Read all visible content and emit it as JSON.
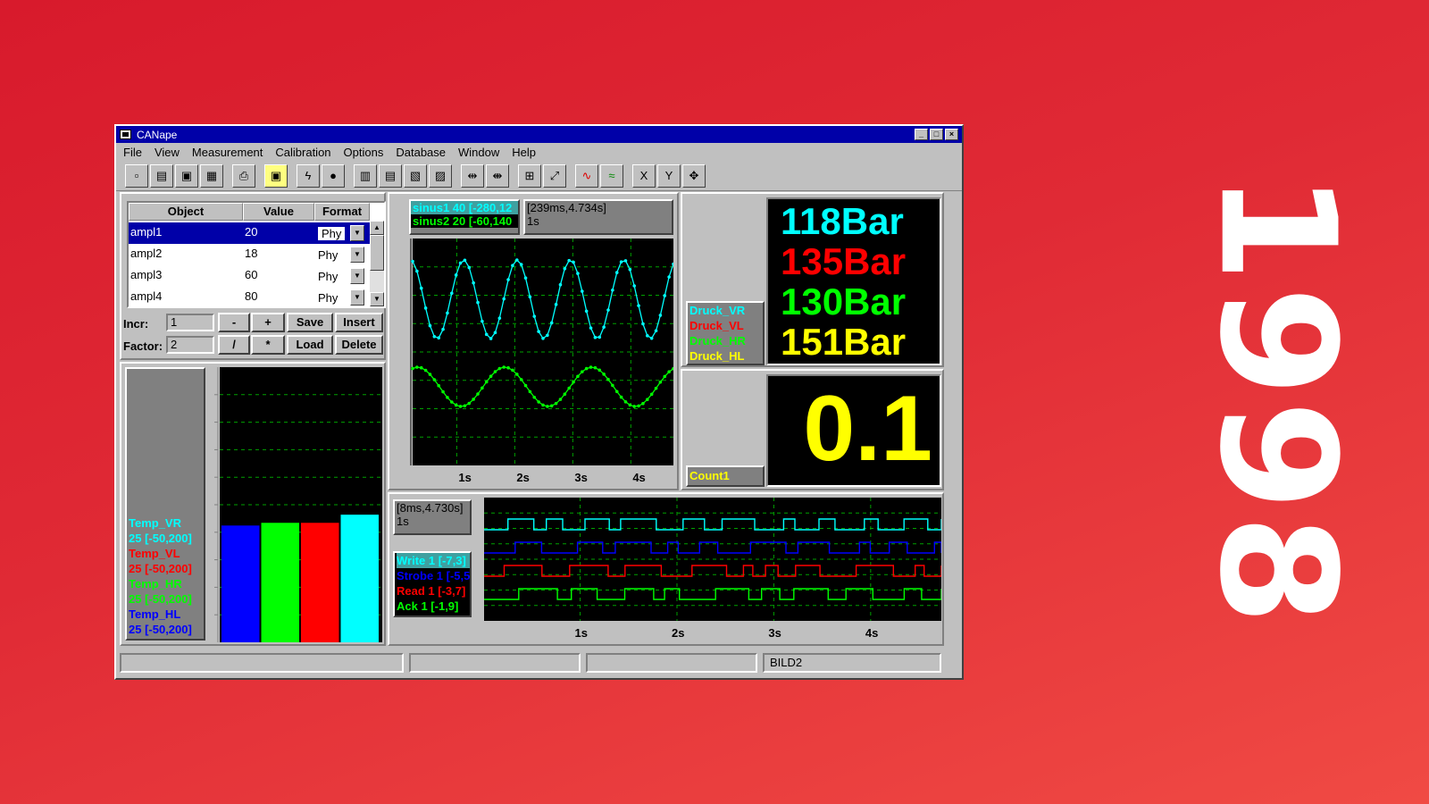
{
  "year": "1998",
  "window": {
    "title": "CANape",
    "controls": [
      "_",
      "□",
      "×"
    ]
  },
  "menu": [
    "File",
    "View",
    "Measurement",
    "Calibration",
    "Options",
    "Database",
    "Window",
    "Help"
  ],
  "table": {
    "headers": [
      "Object",
      "Value",
      "Format"
    ],
    "rows": [
      {
        "object": "ampl1",
        "value": "20",
        "format": "Phy"
      },
      {
        "object": "ampl2",
        "value": "18",
        "format": "Phy"
      },
      {
        "object": "ampl3",
        "value": "60",
        "format": "Phy"
      },
      {
        "object": "ampl4",
        "value": "80",
        "format": "Phy"
      }
    ]
  },
  "calib": {
    "incr_label": "Incr:",
    "incr_value": "1",
    "factor_label": "Factor:",
    "factor_value": "2",
    "minus": "-",
    "plus": "+",
    "divide": "/",
    "multiply": "*",
    "save": "Save",
    "insert": "Insert",
    "load": "Load",
    "delete": "Delete"
  },
  "bars": {
    "legend": [
      {
        "name": "Temp_VR",
        "range": "25 [-50,200]",
        "color": "#00ffff"
      },
      {
        "name": "Temp_VL",
        "range": "25 [-50,200]",
        "color": "#ff0000"
      },
      {
        "name": "Temp_HR",
        "range": "25 [-50,200]",
        "color": "#00ff00"
      },
      {
        "name": "Temp_HL",
        "range": "25 [-50,200]",
        "color": "#0000ff"
      }
    ],
    "values": [
      0.43,
      0.44,
      0.44,
      0.47
    ],
    "colors": [
      "#0000ff",
      "#00ff00",
      "#ff0000",
      "#00ffff"
    ]
  },
  "scope1": {
    "legend": [
      {
        "label": "sinus1 40 [-280,12",
        "color": "#00ffff"
      },
      {
        "label": "sinus2 20 [-60,140",
        "color": "#00ff00"
      }
    ],
    "time_range": "[239ms,4.734s]",
    "time_div": "1s",
    "x_ticks": [
      "1s",
      "2s",
      "3s",
      "4s"
    ]
  },
  "pressure": {
    "legend": [
      {
        "name": "Druck_VR",
        "color": "#00ffff"
      },
      {
        "name": "Druck_VL",
        "color": "#ff0000"
      },
      {
        "name": "Druck_HR",
        "color": "#00ff00"
      },
      {
        "name": "Druck_HL",
        "color": "#ffff00"
      }
    ],
    "readouts": [
      {
        "text": "118Bar",
        "color": "#00ffff"
      },
      {
        "text": "135Bar",
        "color": "#ff0000"
      },
      {
        "text": "130Bar",
        "color": "#00ff00"
      },
      {
        "text": "151Bar",
        "color": "#ffff00"
      }
    ]
  },
  "counter": {
    "label": "Count1",
    "value": "0.1",
    "color": "#ffff00"
  },
  "scope2": {
    "time_range": "[8ms,4.730s]",
    "time_div": "1s",
    "legend": [
      {
        "label": "Write 1 [-7,3]",
        "color": "#00ffff"
      },
      {
        "label": "Strobe 1 [-5,5",
        "color": "#0000ff"
      },
      {
        "label": "Read 1 [-3,7]",
        "color": "#ff0000"
      },
      {
        "label": "Ack 1 [-1,9]",
        "color": "#00ff00"
      }
    ],
    "x_ticks": [
      "1s",
      "2s",
      "3s",
      "4s"
    ]
  },
  "status": {
    "segments": [
      "",
      "",
      "",
      "BILD2"
    ]
  }
}
